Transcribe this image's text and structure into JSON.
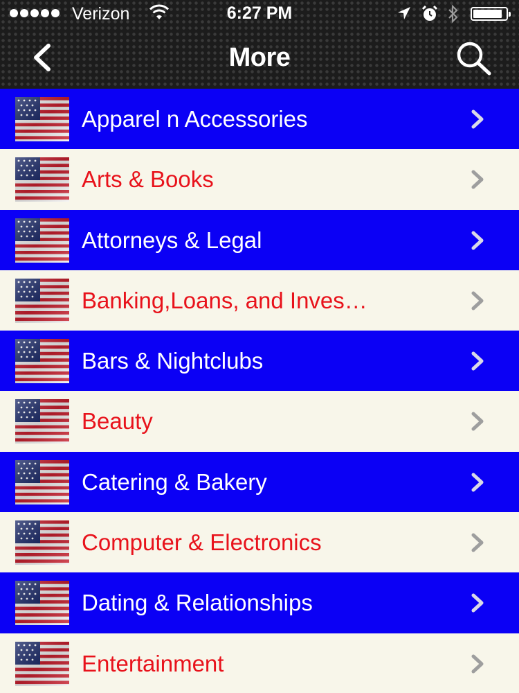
{
  "status_bar": {
    "carrier": "Verizon",
    "time": "6:27 PM",
    "signal_bars": 5,
    "battery_level": 0.9
  },
  "nav": {
    "title": "More",
    "back_icon": "chevron-left-icon",
    "search_icon": "search-icon"
  },
  "colors": {
    "row_blue": "#0b00f5",
    "row_cream": "#f8f6ea",
    "label_blue_row": "#ffffff",
    "label_cream_row": "#e8121b"
  },
  "list": {
    "items": [
      {
        "label": "Apparel n Accessories"
      },
      {
        "label": "Arts & Books"
      },
      {
        "label": "Attorneys & Legal"
      },
      {
        "label": "Banking,Loans, and Inves…"
      },
      {
        "label": "Bars & Nightclubs"
      },
      {
        "label": "Beauty"
      },
      {
        "label": "Catering & Bakery"
      },
      {
        "label": "Computer & Electronics"
      },
      {
        "label": "Dating & Relationships"
      },
      {
        "label": "Entertainment"
      }
    ]
  }
}
